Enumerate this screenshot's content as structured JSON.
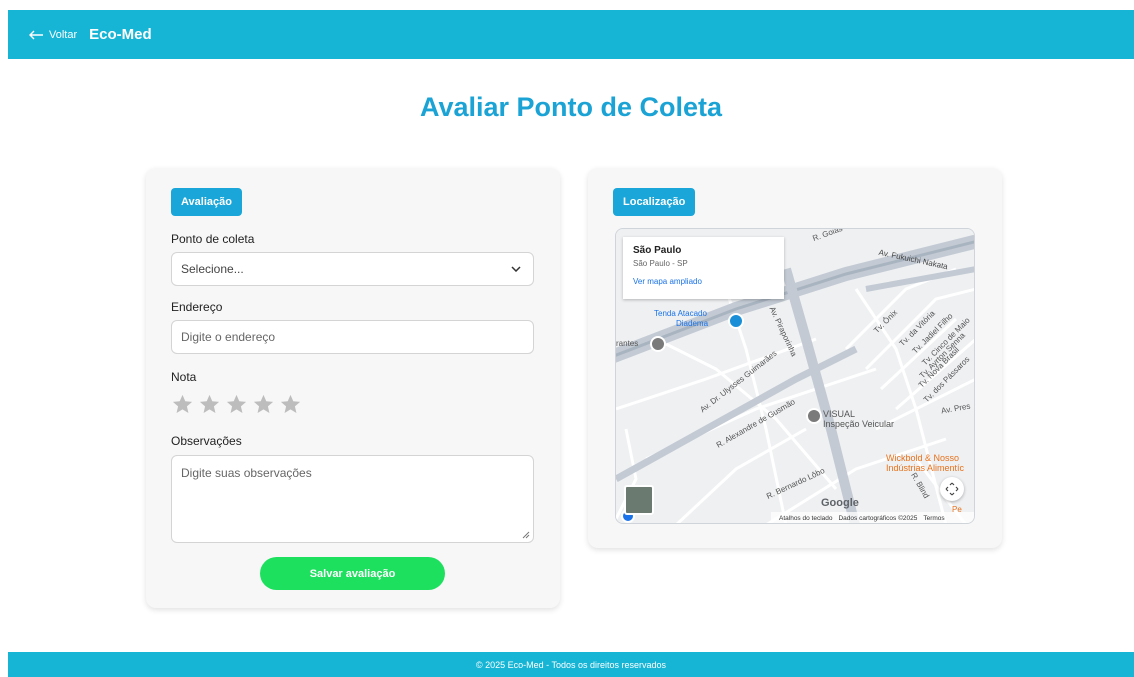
{
  "header": {
    "back_label": "Voltar",
    "brand": "Eco-Med"
  },
  "page": {
    "title": "Avaliar Ponto de Coleta"
  },
  "form": {
    "section_label": "Avaliação",
    "ponto_label": "Ponto de coleta",
    "ponto_selected": "Selecione...",
    "endereco_label": "Endereço",
    "endereco_placeholder": "Digite o endereço",
    "nota_label": "Nota",
    "nota_stars_filled": 0,
    "nota_stars_total": 5,
    "obs_label": "Observações",
    "obs_placeholder": "Digite suas observações",
    "save_label": "Salvar avaliação"
  },
  "location": {
    "section_label": "Localização",
    "infobox": {
      "title": "São Paulo",
      "subtitle": "São Paulo - SP",
      "link": "Ver mapa ampliado"
    },
    "labels": {
      "goias": "R. Goiás",
      "fukuichi": "Av. Fukuichi Nakata",
      "tenda": "Tenda Atacado",
      "diadema": "Diadema",
      "rantes": "rantes",
      "piraporinha": "Av. Piraporinha",
      "ulysses": "Av. Dr. Ulysses Guimarães",
      "alexandre": "R. Alexandre de Gusmão",
      "visual": "VISUAL",
      "inspecao": "Inspeção Veicular",
      "onix": "Tv. Ônix",
      "vitoria": "Tv. da Vitória",
      "jadiel": "Tv. Jadiel Filho",
      "cinco": "Tv. Cinco de Maio",
      "ayrton": "Tv. Ayrton Senna",
      "nova_brasil": "Tv. Nova Brasil",
      "passaros": "Tv. dos Pássaros",
      "av_pres": "Av. Pres",
      "wickbold": "Wickbold & Nosso",
      "industrias": "Indústrias Alimentíc",
      "bernardo": "R. Bernardo Lôbo",
      "blind": "R. Blind",
      "google": "Google",
      "atalhos": "Atalhos do teclado",
      "dados": "Dados cartográficos ©2025",
      "termos": "Termos",
      "pec": "Pe"
    }
  },
  "footer": {
    "text": "© 2025 Eco-Med - Todos os direitos reservados"
  },
  "colors": {
    "primary": "#16b5d6",
    "title": "#1aa3d4",
    "save_button": "#1ee05f",
    "star_empty": "#bdbdbd"
  }
}
